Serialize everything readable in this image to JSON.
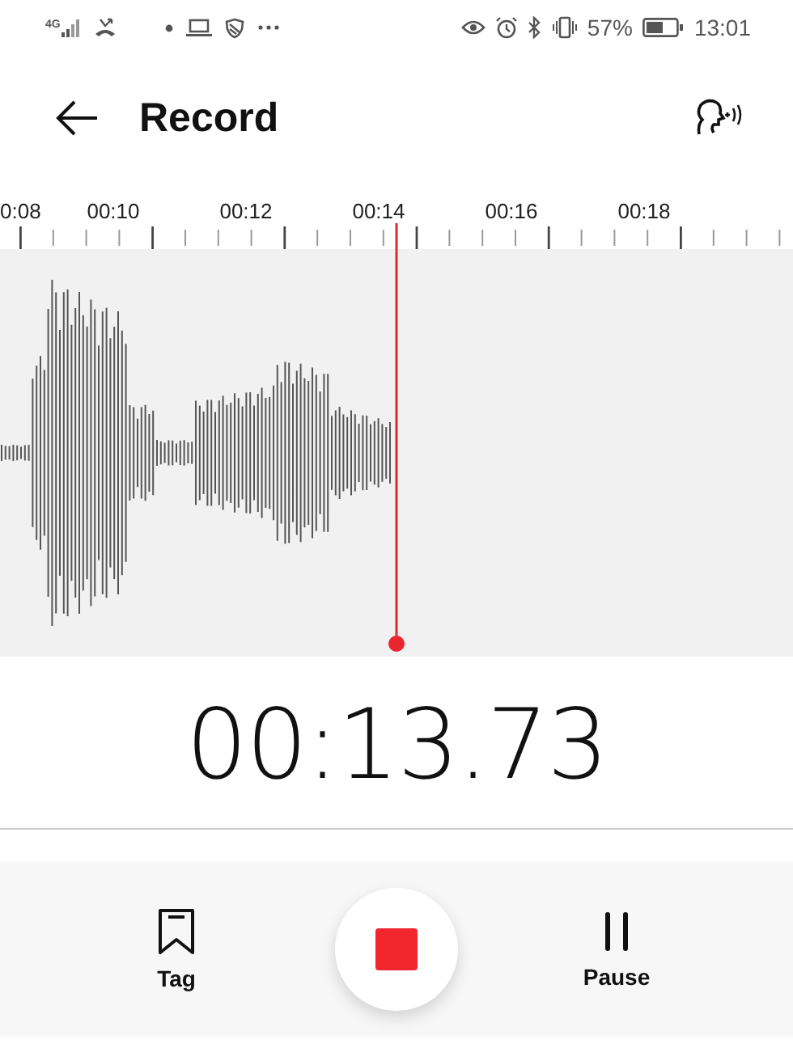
{
  "status_bar": {
    "network": "4G",
    "battery_percent": "57%",
    "time": "13:01"
  },
  "header": {
    "title": "Record"
  },
  "ruler": {
    "labels": [
      "0:08",
      "00:10",
      "00:12",
      "00:14",
      "00:16",
      "00:18"
    ]
  },
  "timer": "00:13.73",
  "controls": [
    {
      "kind": "tag",
      "label": "Tag"
    },
    {
      "kind": "stop"
    },
    {
      "kind": "pause",
      "label": "Pause"
    }
  ]
}
